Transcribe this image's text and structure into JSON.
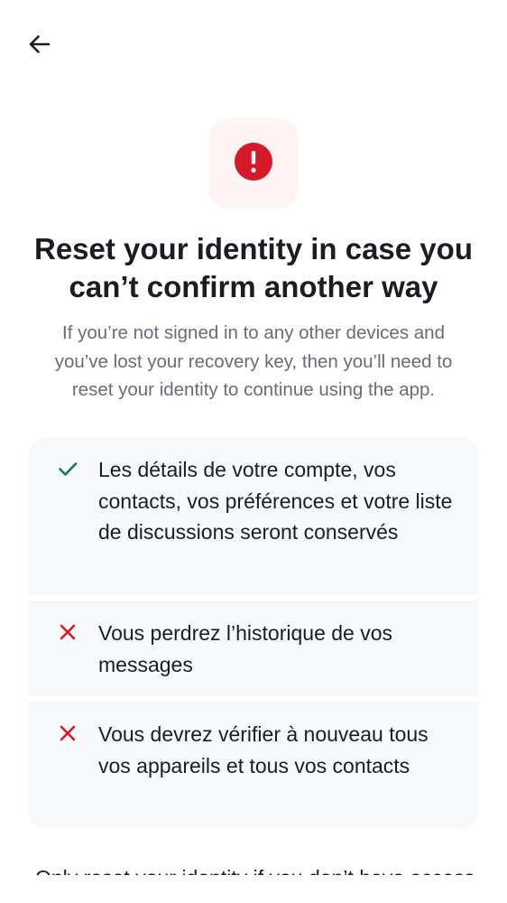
{
  "header": {
    "back_icon": "arrow-left-icon"
  },
  "alert": {
    "icon": "error-icon",
    "glyph": "!",
    "tile_color": "#fff4f4",
    "icon_color": "#d51928"
  },
  "title": {
    "line1": "Reset your identity in case you",
    "line2": "can’t confirm another way"
  },
  "subtitle": {
    "line1": "If you’re not signed in to any other devices and",
    "line2": "you’ve lost your recovery key, then you’ll need to",
    "line3": "reset your identity to continue using the app."
  },
  "consequences": {
    "items": [
      {
        "icon": "check-icon",
        "status": "kept",
        "color": "#0b7a5c",
        "text": "Les détails de votre compte, vos contacts, vos préférences et votre liste de discussions seront conservés"
      },
      {
        "icon": "close-icon",
        "status": "lost",
        "color": "#d51928",
        "text": "Vous perdrez l’historique de vos messages"
      },
      {
        "icon": "close-icon",
        "status": "lost",
        "color": "#d51928",
        "text": "Vous devrez vérifier à nouveau tous vos appareils et tous vos contacts"
      }
    ]
  },
  "footer": {
    "text": "Only reset your identity if you don’t have access"
  }
}
